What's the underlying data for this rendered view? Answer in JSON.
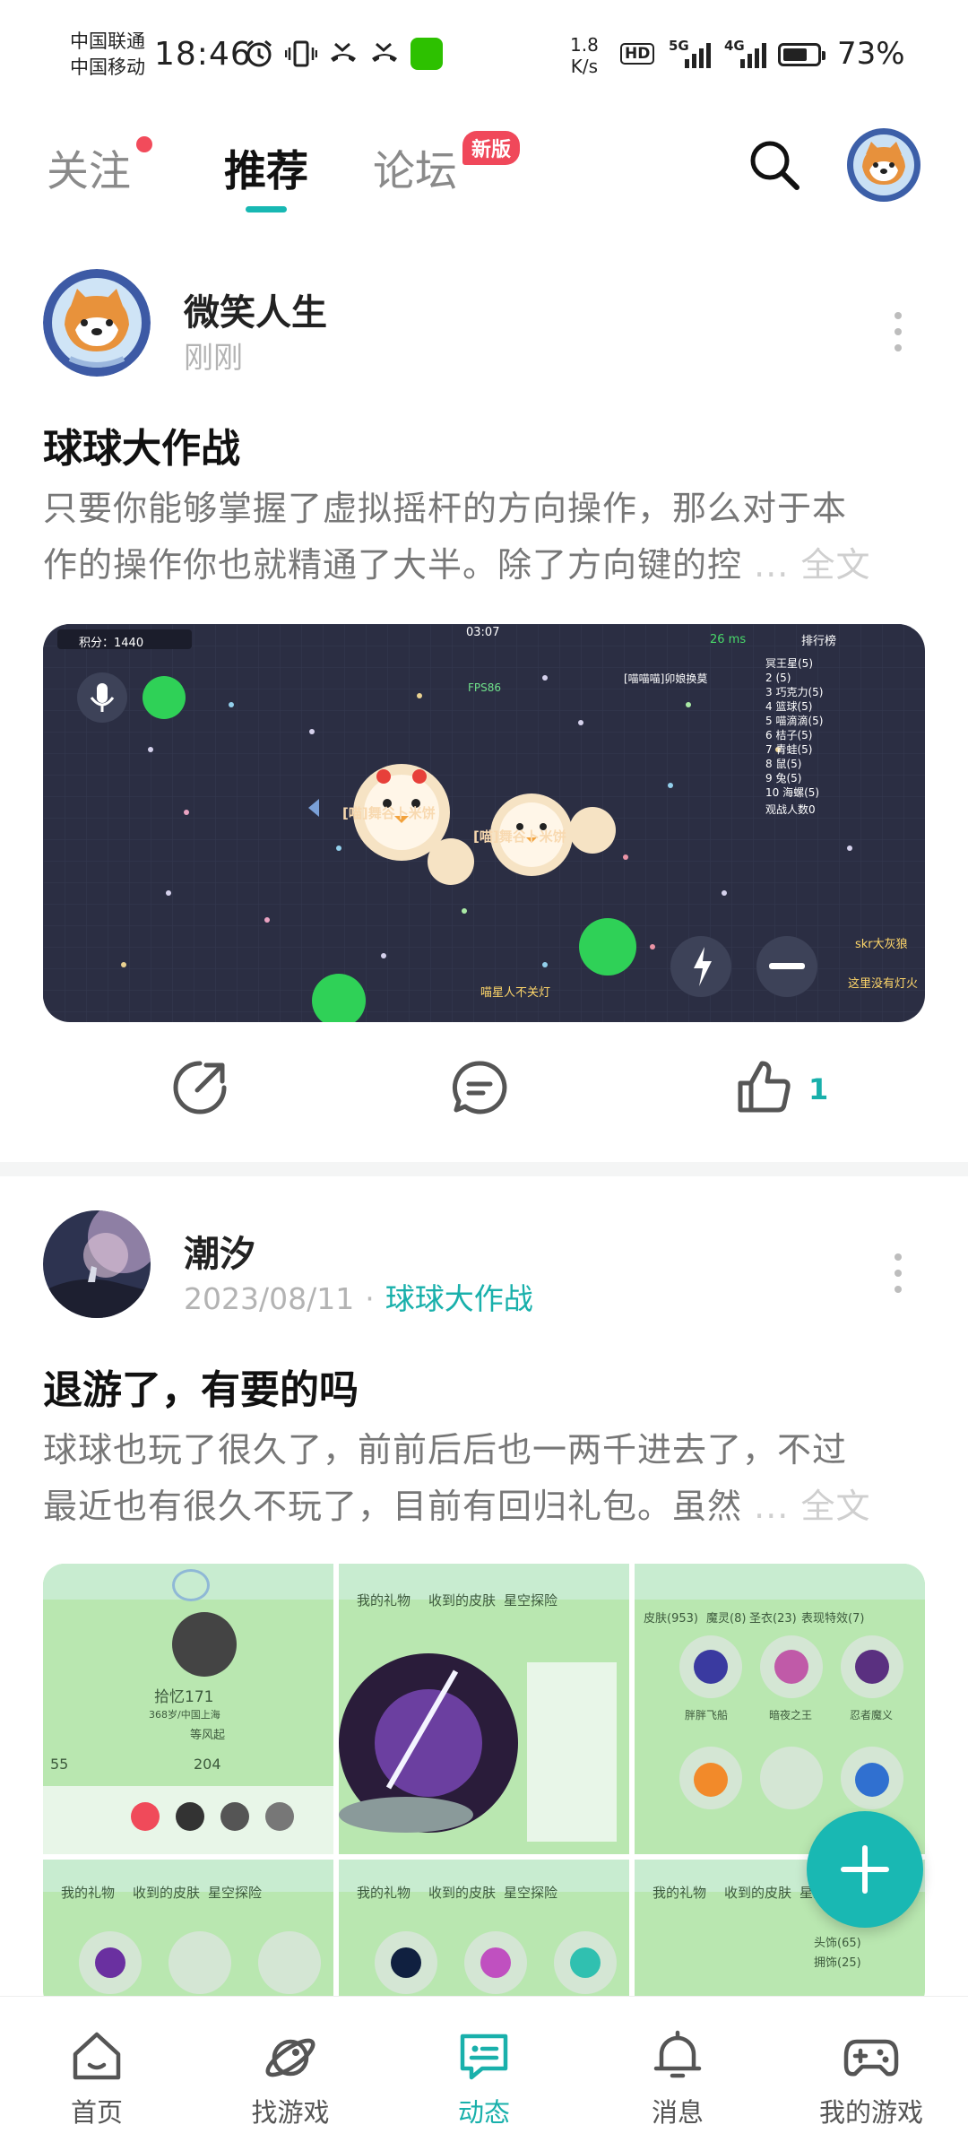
{
  "status_bar": {
    "carrier1": "中国联通",
    "carrier2": "中国移动",
    "time": "18:46",
    "speed_value": "1.8",
    "speed_unit": "K/s",
    "hd": "HD",
    "net1": "5G",
    "net2": "4G",
    "battery_level": 0.73,
    "battery_text": "73%"
  },
  "top_nav": {
    "tabs": [
      {
        "label": "关注"
      },
      {
        "label": "推荐"
      },
      {
        "label": "论坛"
      }
    ],
    "forum_badge": "新版",
    "active_tab": "推荐"
  },
  "posts": [
    {
      "username": "微笑人生",
      "time": "刚刚",
      "title": "球球大作战",
      "body_line1": "只要你能够掌握了虚拟摇杆的方向操作，那么对于本",
      "body_line2": "作的操作你也就精通了大半。除了方向键的控",
      "ellipsis": "...",
      "full_text": "全文",
      "like_count": "1",
      "game_screen": {
        "score": "积分：1440",
        "timer": "03:07",
        "ping": "26 ms",
        "board_title": "排行榜",
        "fps": "FPS86",
        "player_a": "[喵]舞谷卜米饼",
        "player_b": "[喵]舞谷卜米饼",
        "other_player": "[喵喵喵]卯娘换莫",
        "leaderboard": [
          "冥王星(5)",
          "2 (5)",
          "3 巧克力(5)",
          "4 篮球(5)",
          "5 喵滴滴(5)",
          "6 桔子(5)",
          "7 青蛙(5)",
          "8 鼠(5)",
          "9 兔(5)",
          "10 海螺(5)"
        ],
        "spectators": "观战人数0",
        "chat1": "skr大灰狼",
        "chat2": "这里没有灯火",
        "chat3": "喵星人不关灯"
      }
    },
    {
      "username": "潮汐",
      "date": "2023/08/11",
      "game_tag": "球球大作战",
      "title": "退游了，有要的吗",
      "body_line1": "球球也玩了很久了，前前后后也一两千进去了，不过",
      "body_line2": "最近也有很久不玩了，目前有回归礼包。虽然",
      "ellipsis": "...",
      "full_text": "全文",
      "grid_tabs": [
        "我的礼物",
        "收到的皮肤",
        "星空探险"
      ],
      "grid_sub": [
        "皮肤(953)",
        "魔灵(8)",
        "圣衣(23)",
        "表现特效(7)"
      ],
      "profile_name": "拾忆171",
      "profile_loc": "368岁/中国上海",
      "profile_tag": "等风起",
      "profile_stats": [
        "55",
        "204"
      ],
      "skin_names": [
        "胖胖飞船",
        "暗夜之王",
        "忍者魔义"
      ],
      "extra_list": [
        "头饰(65)",
        "拥饰(25)"
      ]
    }
  ],
  "bottom_nav": [
    {
      "label": "首页",
      "icon": "home-icon"
    },
    {
      "label": "找游戏",
      "icon": "planet-icon"
    },
    {
      "label": "动态",
      "icon": "chat-icon"
    },
    {
      "label": "消息",
      "icon": "bell-icon"
    },
    {
      "label": "我的游戏",
      "icon": "gamepad-icon"
    }
  ],
  "colors": {
    "accent": "#19b0ab",
    "badge_red": "#f0485a",
    "game_bg": "#2b2e43",
    "grid_green": "#b9e7b0"
  }
}
